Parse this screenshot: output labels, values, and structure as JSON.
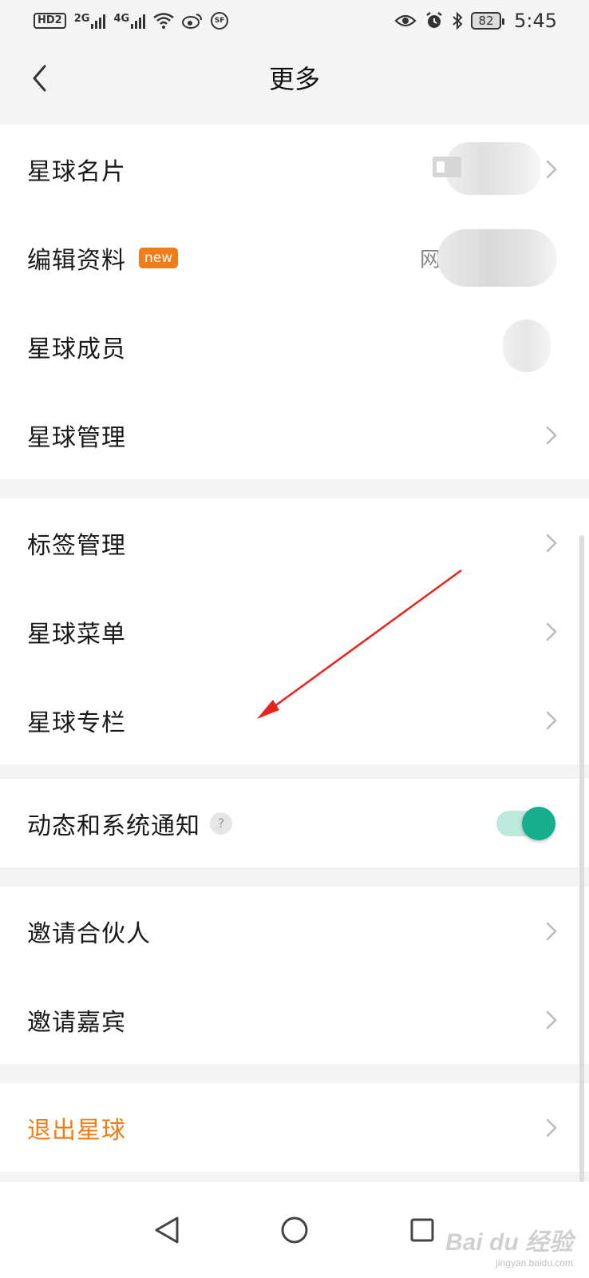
{
  "status_bar": {
    "hd_label": "HD",
    "sim_label": "2",
    "net_2g": "2G",
    "net_4g": "4G",
    "sf_label": "SF",
    "battery": "82",
    "time": "5:45"
  },
  "header": {
    "title": "更多"
  },
  "section1": {
    "items": [
      {
        "label": "星球名片"
      },
      {
        "label": "编辑资料",
        "badge": "new",
        "value": "网络"
      },
      {
        "label": "星球成员"
      },
      {
        "label": "星球管理"
      }
    ]
  },
  "section2": {
    "items": [
      {
        "label": "标签管理"
      },
      {
        "label": "星球菜单"
      },
      {
        "label": "星球专栏"
      }
    ]
  },
  "section3": {
    "items": [
      {
        "label": "动态和系统通知",
        "help": "?",
        "toggle_on": true
      }
    ]
  },
  "section4": {
    "items": [
      {
        "label": "邀请合伙人"
      },
      {
        "label": "邀请嘉宾"
      }
    ]
  },
  "section5": {
    "items": [
      {
        "label": "退出星球"
      }
    ]
  },
  "watermark": {
    "brand": "Bai du 经验",
    "url": "jingyan.baidu.com"
  },
  "colors": {
    "accent_orange": "#f07d1a",
    "toggle_green": "#17ad8f",
    "annotation_red": "#e8221c"
  }
}
